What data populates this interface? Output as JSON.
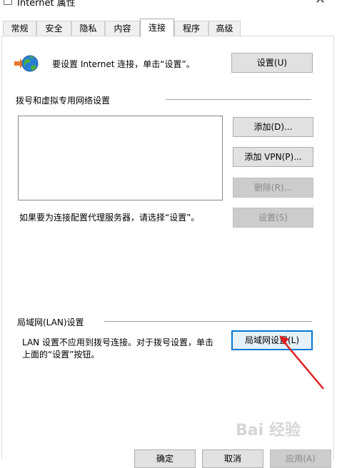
{
  "window": {
    "title": "Internet 属性",
    "close_glyph": "✕"
  },
  "tabs": [
    {
      "label": "常规"
    },
    {
      "label": "安全"
    },
    {
      "label": "隐私"
    },
    {
      "label": "内容"
    },
    {
      "label": "连接",
      "active": true
    },
    {
      "label": "程序"
    },
    {
      "label": "高级"
    }
  ],
  "setup": {
    "icon": "globe-network-icon",
    "text": "要设置 Internet 连接，单击“设置”。",
    "button": "设置(U)"
  },
  "dialup": {
    "heading": "拨号和虚拟专用网络设置",
    "add_button": "添加(D)...",
    "add_vpn_button": "添加 VPN(P)...",
    "delete_button": "删除(R)...",
    "proxy_text": "如果要为连接配置代理服务器，请选择“设置”。",
    "settings_button": "设置(S)"
  },
  "lan": {
    "heading": "局域网(LAN)设置",
    "text_line1": "LAN 设置不应用到拨号连接。对于拨号设置，单击",
    "text_line2": "上面的“设置”按钮。",
    "button": "局域网设置(L)"
  },
  "footer": {
    "ok": "确定",
    "cancel": "取消",
    "apply": "应用(A)"
  },
  "annotation": {
    "arrow_color": "#e02020"
  },
  "watermark": "Bai 经验"
}
